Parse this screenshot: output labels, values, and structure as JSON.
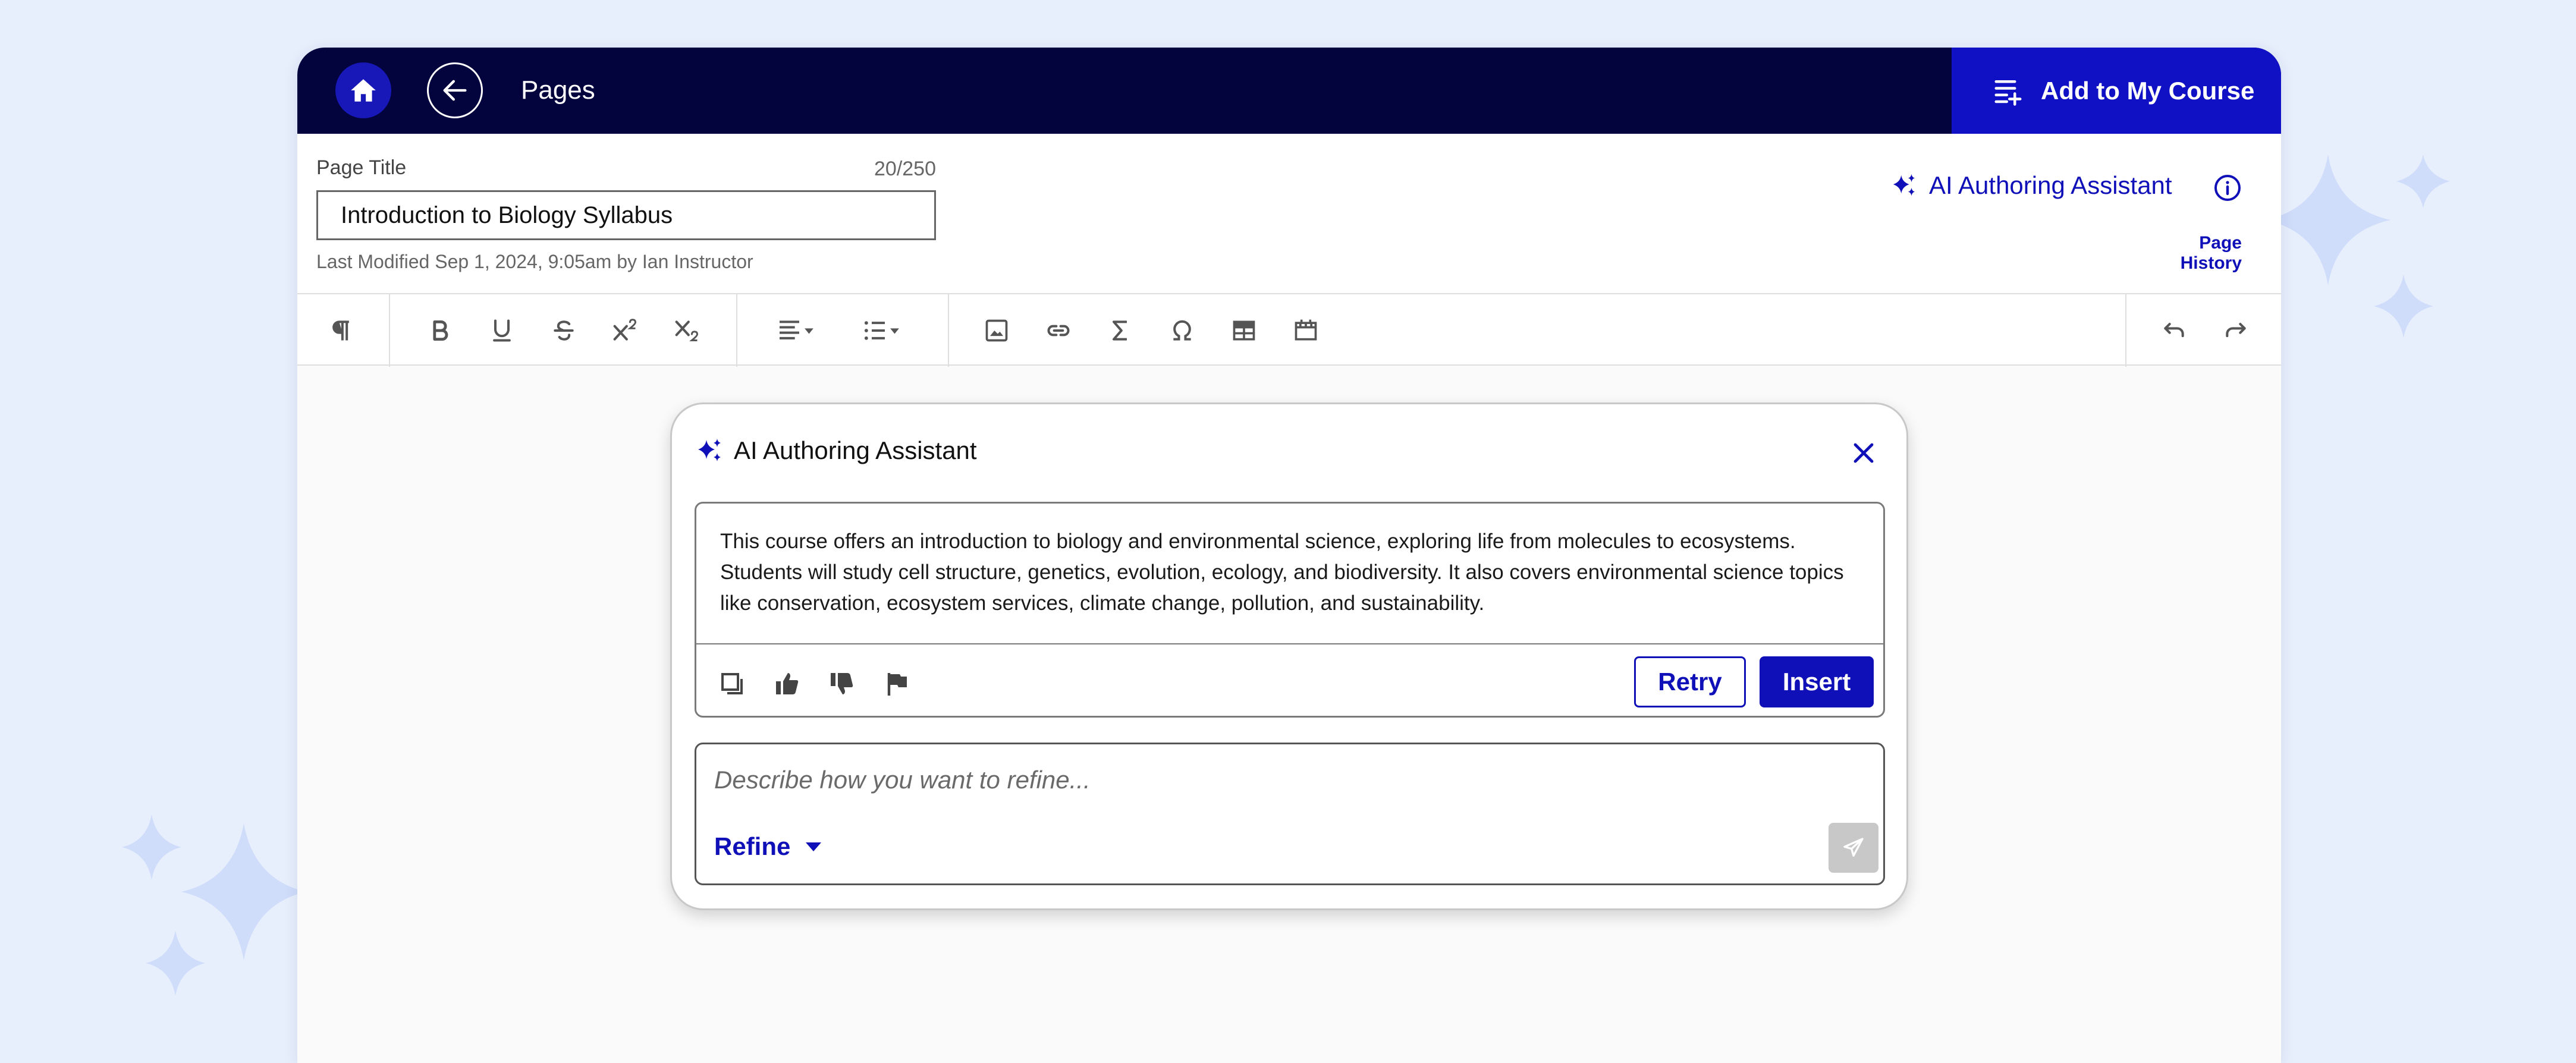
{
  "topbar": {
    "home_icon": "home-icon",
    "back_icon": "arrow-left-icon",
    "title": "Pages",
    "add_course_label": "Add to My Course",
    "add_course_icon": "playlist-add-icon"
  },
  "header": {
    "title_label": "Page Title",
    "title_count": "20/250",
    "title_value": "Introduction to Biology Syllabus",
    "last_modified": "Last Modified Sep 1, 2024, 9:05am by Ian Instructor",
    "ai_assistant_label": "AI Authoring Assistant",
    "page_history_label": "Page History"
  },
  "toolbar": {
    "buttons": [
      "paragraph-icon",
      "bold-icon",
      "underline-icon",
      "strikethrough-icon",
      "superscript-icon",
      "subscript-icon",
      "align-left-icon",
      "bullet-list-icon",
      "image-icon",
      "link-icon",
      "sigma-icon",
      "omega-icon",
      "table-icon",
      "media-icon",
      "undo-icon",
      "redo-icon"
    ]
  },
  "assistant": {
    "title": "AI Authoring Assistant",
    "response": "This course offers an introduction to biology and environmental science, exploring life from molecules to ecosystems. Students will study cell structure, genetics, evolution, ecology, and biodiversity. It also covers environmental science topics like conservation, ecosystem services, climate change, pollution, and sustainability.",
    "retry_label": "Retry",
    "insert_label": "Insert",
    "refine_placeholder": "Describe how you want to refine...",
    "refine_label": "Refine"
  },
  "colors": {
    "topbar_bg": "#03033d",
    "accent": "#1010b8",
    "add_course_bg": "#1010c4",
    "page_bg": "#e7effd"
  }
}
